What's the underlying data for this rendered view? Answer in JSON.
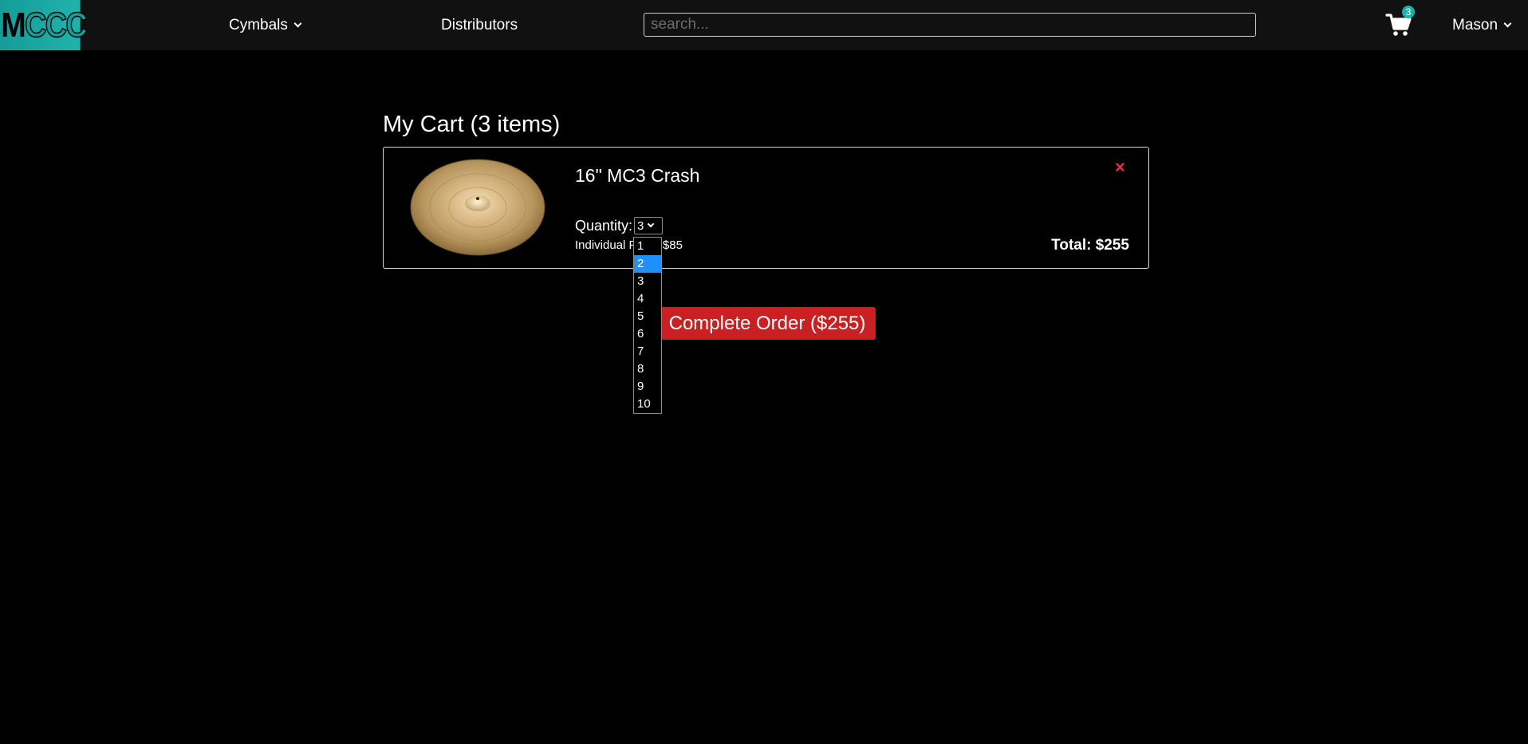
{
  "brand": {
    "logo_first": "M",
    "logo_rest": "CCC",
    "accent_color": "#1ab3a6"
  },
  "nav": {
    "cymbals_label": "Cymbals",
    "distributors_label": "Distributors",
    "search_placeholder": "search...",
    "cart_count": "3",
    "user_name": "Mason"
  },
  "cart": {
    "title": "My Cart (3 items)",
    "items": [
      {
        "name": "16\" MC3 Crash",
        "quantity_label": "Quantity:",
        "quantity_value": "3",
        "individual_price_label": "Individual Price:",
        "individual_price": "$85",
        "total_label": "Total: $255",
        "remove_symbol": "×"
      }
    ],
    "complete_order_label": "Complete Order ($255)",
    "button_color": "#c82023"
  },
  "quantity_dropdown": {
    "options": [
      "1",
      "2",
      "3",
      "4",
      "5",
      "6",
      "7",
      "8",
      "9",
      "10"
    ],
    "highlighted": "2",
    "highlight_color": "#1e90ff"
  }
}
